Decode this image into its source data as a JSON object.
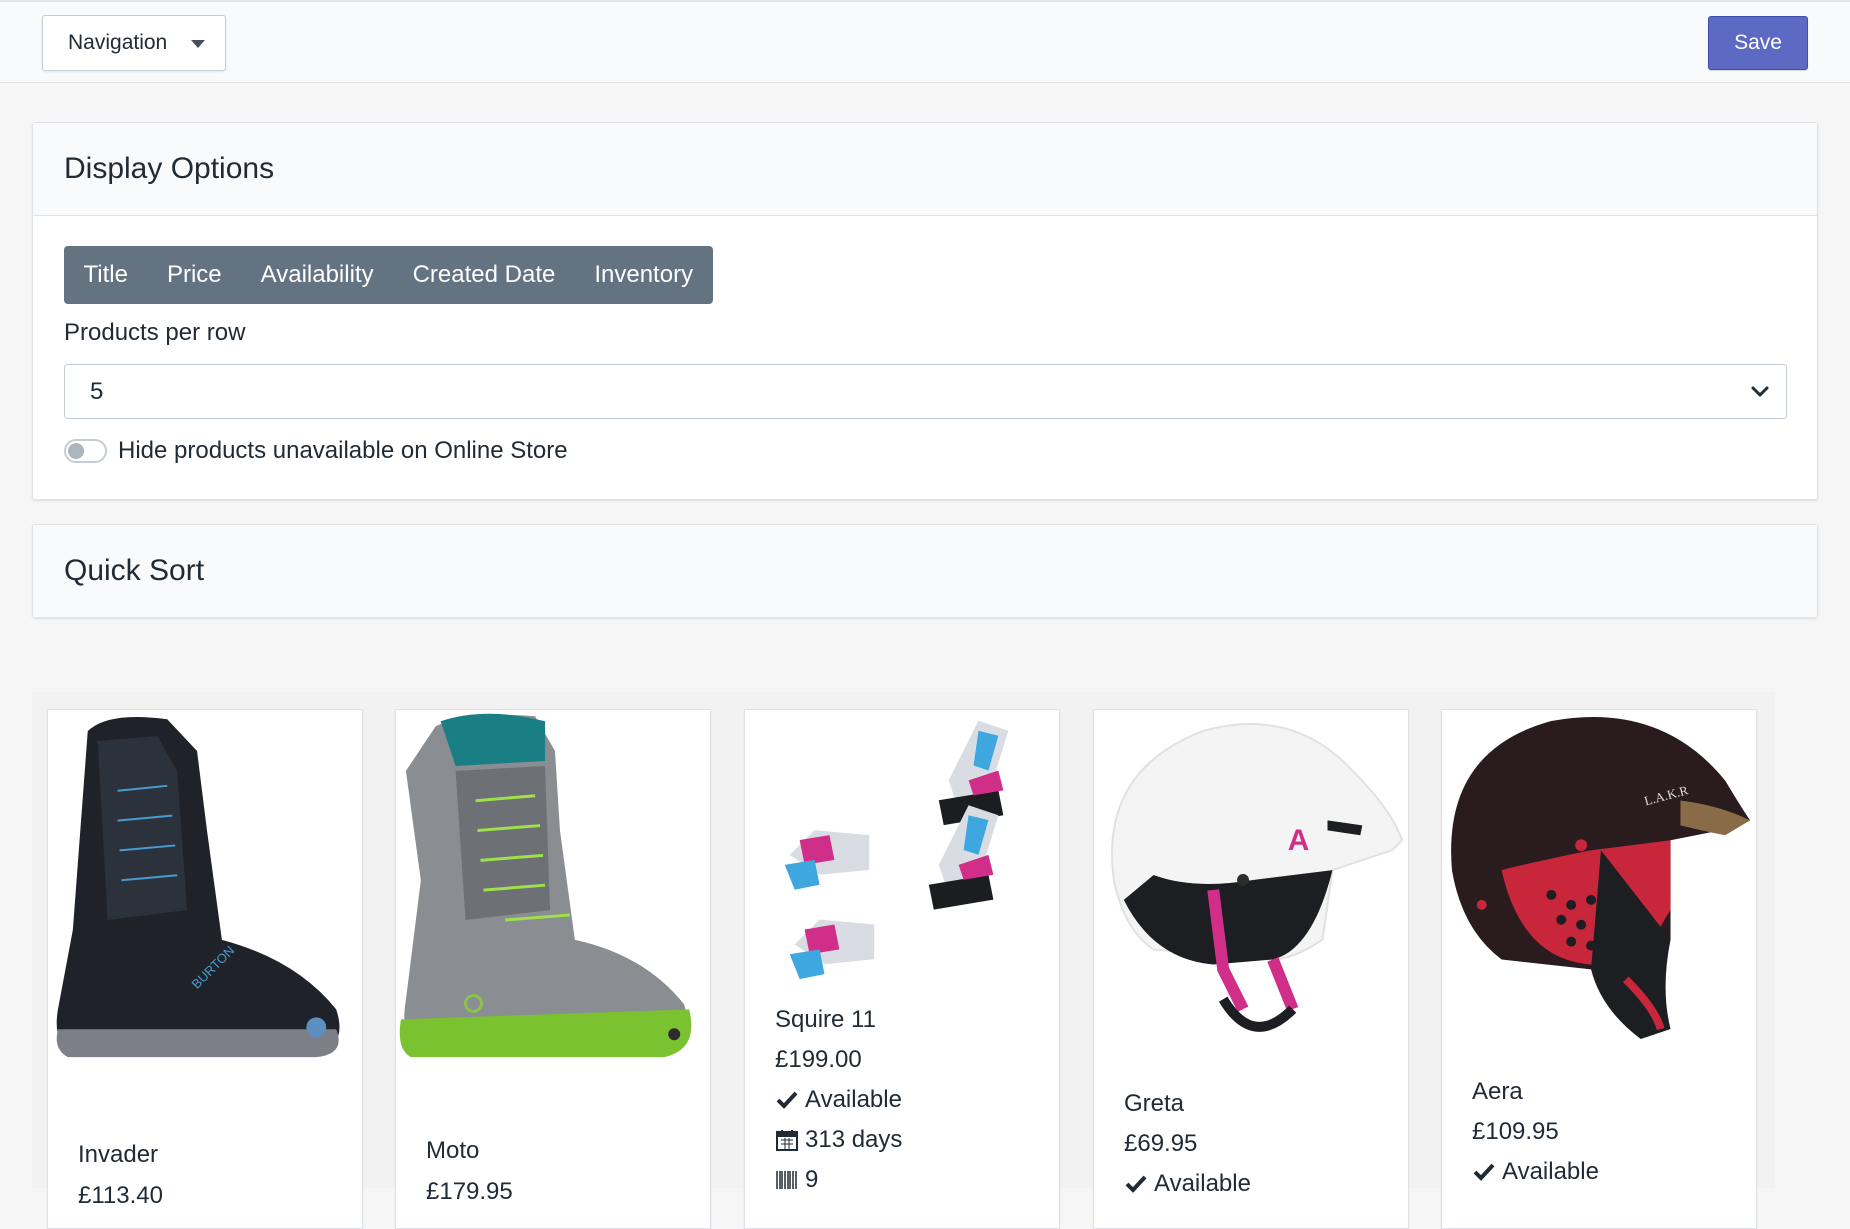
{
  "topbar": {
    "navigation_label": "Navigation",
    "save_label": "Save"
  },
  "display_options": {
    "title": "Display Options",
    "fields": [
      "Title",
      "Price",
      "Availability",
      "Created Date",
      "Inventory"
    ],
    "products_per_row_label": "Products per row",
    "products_per_row_value": "5",
    "hide_unavailable_label": "Hide products unavailable on Online Store",
    "hide_unavailable_enabled": false
  },
  "quick_sort": {
    "title": "Quick Sort"
  },
  "colors": {
    "accent": "#5c6ac4",
    "segment_bg": "#637381"
  },
  "products": [
    {
      "name": "Invader",
      "price": "£113.40",
      "image": "black snowboard boot"
    },
    {
      "name": "Moto",
      "price": "£179.95",
      "image": "grey and green snowboard boot"
    },
    {
      "name": "Squire 11",
      "price": "£199.00",
      "availability": "Available",
      "created": "313 days",
      "inventory": "9",
      "image": "ski bindings"
    },
    {
      "name": "Greta",
      "price": "£69.95",
      "availability": "Available",
      "image": "white helmet"
    },
    {
      "name": "Aera",
      "price": "£109.95",
      "availability": "Available",
      "image": "dark helmet"
    }
  ]
}
